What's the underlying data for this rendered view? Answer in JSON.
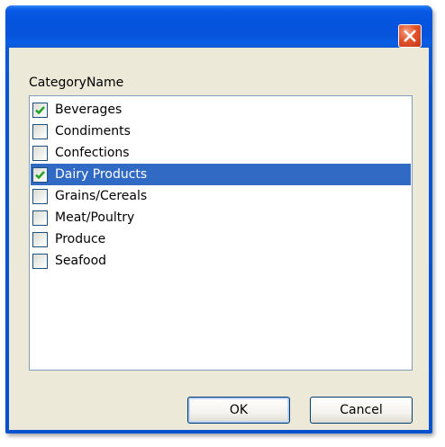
{
  "dialog": {
    "caption": "CategoryName",
    "items": [
      {
        "label": "Beverages",
        "checked": true,
        "selected": false
      },
      {
        "label": "Condiments",
        "checked": false,
        "selected": false
      },
      {
        "label": "Confections",
        "checked": false,
        "selected": false
      },
      {
        "label": "Dairy Products",
        "checked": true,
        "selected": true
      },
      {
        "label": "Grains/Cereals",
        "checked": false,
        "selected": false
      },
      {
        "label": "Meat/Poultry",
        "checked": false,
        "selected": false
      },
      {
        "label": "Produce",
        "checked": false,
        "selected": false
      },
      {
        "label": "Seafood",
        "checked": false,
        "selected": false
      }
    ],
    "ok_label": "OK",
    "cancel_label": "Cancel"
  },
  "icons": {
    "close": "close-icon",
    "check": "checkmark-icon"
  },
  "colors": {
    "titlebar": "#0554de",
    "dialog_background": "#ece9d8",
    "selection": "#316ac5",
    "close_button": "#e2542b",
    "checkmark": "#21a121"
  }
}
